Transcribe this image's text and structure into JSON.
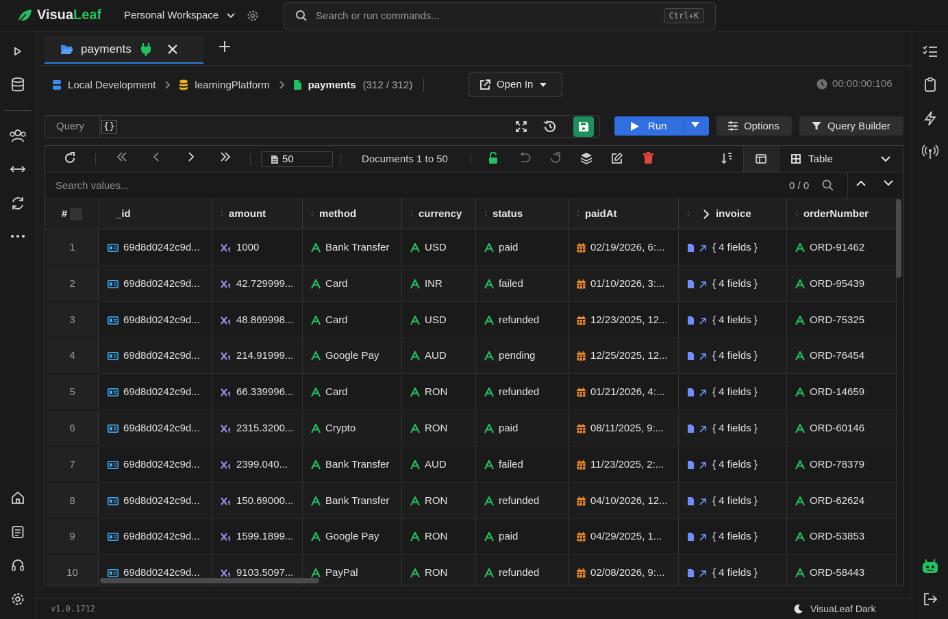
{
  "app": {
    "name_a": "Visua",
    "name_b": "Leaf",
    "workspace": "Personal Workspace"
  },
  "search": {
    "placeholder": "Search or run commands...",
    "shortcut": "Ctrl+K"
  },
  "tabs": [
    {
      "label": "payments"
    }
  ],
  "breadcrumb": {
    "connection": "Local Development",
    "database": "learningPlatform",
    "collection": "payments",
    "count": "(312 / 312)"
  },
  "open_in": {
    "label": "Open In"
  },
  "timer": "00:00:00:106",
  "query": {
    "label": "Query",
    "value": "{}"
  },
  "buttons": {
    "run": "Run",
    "options": "Options",
    "query_builder": "Query Builder"
  },
  "toolbar": {
    "page_size": "50",
    "docs_info": "Documents 1 to 50",
    "view": "Table"
  },
  "search_values": {
    "placeholder": "Search values...",
    "count": "0 / 0"
  },
  "columns": {
    "num": "#",
    "id": "_id",
    "amount": "amount",
    "method": "method",
    "currency": "currency",
    "status": "status",
    "paidAt": "paidAt",
    "invoice": "invoice",
    "orderNumber": "orderNumber"
  },
  "rows": [
    {
      "n": "1",
      "id": "69d8d0242c9d...",
      "amount": "1000",
      "method": "Bank Transfer",
      "currency": "USD",
      "status": "paid",
      "paidAt": "02/19/2026, 6:...",
      "invoice": "{ 4 fields }",
      "order": "ORD-91462"
    },
    {
      "n": "2",
      "id": "69d8d0242c9d...",
      "amount": "42.729999...",
      "method": "Card",
      "currency": "INR",
      "status": "failed",
      "paidAt": "01/10/2026, 3:...",
      "invoice": "{ 4 fields }",
      "order": "ORD-95439"
    },
    {
      "n": "3",
      "id": "69d8d0242c9d...",
      "amount": "48.869998...",
      "method": "Card",
      "currency": "USD",
      "status": "refunded",
      "paidAt": "12/23/2025, 12...",
      "invoice": "{ 4 fields }",
      "order": "ORD-75325"
    },
    {
      "n": "4",
      "id": "69d8d0242c9d...",
      "amount": "214.91999...",
      "method": "Google Pay",
      "currency": "AUD",
      "status": "pending",
      "paidAt": "12/25/2025, 12...",
      "invoice": "{ 4 fields }",
      "order": "ORD-76454"
    },
    {
      "n": "5",
      "id": "69d8d0242c9d...",
      "amount": "66.339996...",
      "method": "Card",
      "currency": "RON",
      "status": "refunded",
      "paidAt": "01/21/2026, 4:...",
      "invoice": "{ 4 fields }",
      "order": "ORD-14659"
    },
    {
      "n": "6",
      "id": "69d8d0242c9d...",
      "amount": "2315.3200...",
      "method": "Crypto",
      "currency": "RON",
      "status": "paid",
      "paidAt": "08/11/2025, 9:...",
      "invoice": "{ 4 fields }",
      "order": "ORD-60146"
    },
    {
      "n": "7",
      "id": "69d8d0242c9d...",
      "amount": "2399.040...",
      "method": "Bank Transfer",
      "currency": "AUD",
      "status": "failed",
      "paidAt": "11/23/2025, 2:...",
      "invoice": "{ 4 fields }",
      "order": "ORD-78379"
    },
    {
      "n": "8",
      "id": "69d8d0242c9d...",
      "amount": "150.69000...",
      "method": "Bank Transfer",
      "currency": "RON",
      "status": "refunded",
      "paidAt": "04/10/2026, 12...",
      "invoice": "{ 4 fields }",
      "order": "ORD-62624"
    },
    {
      "n": "9",
      "id": "69d8d0242c9d...",
      "amount": "1599.1899...",
      "method": "Google Pay",
      "currency": "RON",
      "status": "paid",
      "paidAt": "04/29/2025, 1...",
      "invoice": "{ 4 fields }",
      "order": "ORD-53853"
    },
    {
      "n": "10",
      "id": "69d8d0242c9d...",
      "amount": "9103.5097...",
      "method": "PayPal",
      "currency": "RON",
      "status": "refunded",
      "paidAt": "02/08/2026, 9:...",
      "invoice": "{ 4 fields }",
      "order": "ORD-58443"
    }
  ],
  "footer": {
    "version": "v1.0.1712",
    "theme": "VisuaLeaf Dark"
  },
  "colors": {
    "accent_green": "#21c25e",
    "run_blue": "#2f6fe0",
    "delete_red": "#e0443a",
    "date_orange": "#f08a24",
    "id_blue": "#3fa9f5",
    "number_purple": "#a98bf5",
    "invoice_blue": "#6f8dff"
  }
}
